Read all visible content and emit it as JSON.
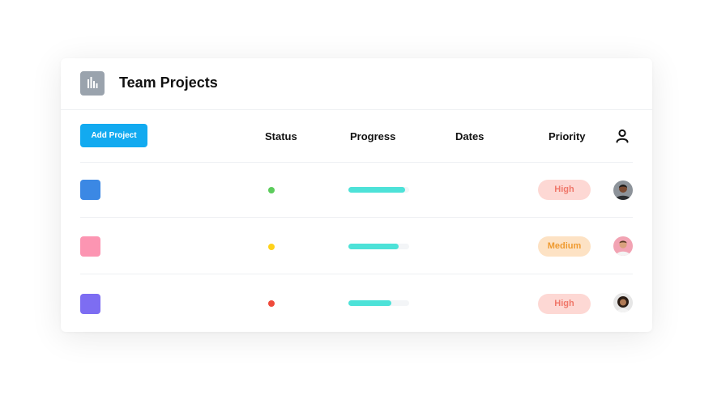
{
  "header": {
    "title": "Team Projects",
    "icon": "bar-chart-icon"
  },
  "toolbar": {
    "add_label": "Add Project"
  },
  "columns": {
    "status": "Status",
    "progress": "Progress",
    "dates": "Dates",
    "priority": "Priority",
    "assignee_icon": "user-icon"
  },
  "rows": [
    {
      "color": "#3b88e4",
      "status_color": "#5ccc5c",
      "progress": 0.93,
      "dates": "",
      "priority": "High",
      "priority_bg": "#fdd8d4",
      "priority_fg": "#f0776a"
    },
    {
      "color": "#fc95b2",
      "status_color": "#ffd21a",
      "progress": 0.83,
      "dates": "",
      "priority": "Medium",
      "priority_bg": "#fde2c4",
      "priority_fg": "#ef9a30"
    },
    {
      "color": "#7d6df2",
      "status_color": "#ef4a3b",
      "progress": 0.7,
      "dates": "",
      "priority": "High",
      "priority_bg": "#fdd8d4",
      "priority_fg": "#f0776a"
    }
  ]
}
